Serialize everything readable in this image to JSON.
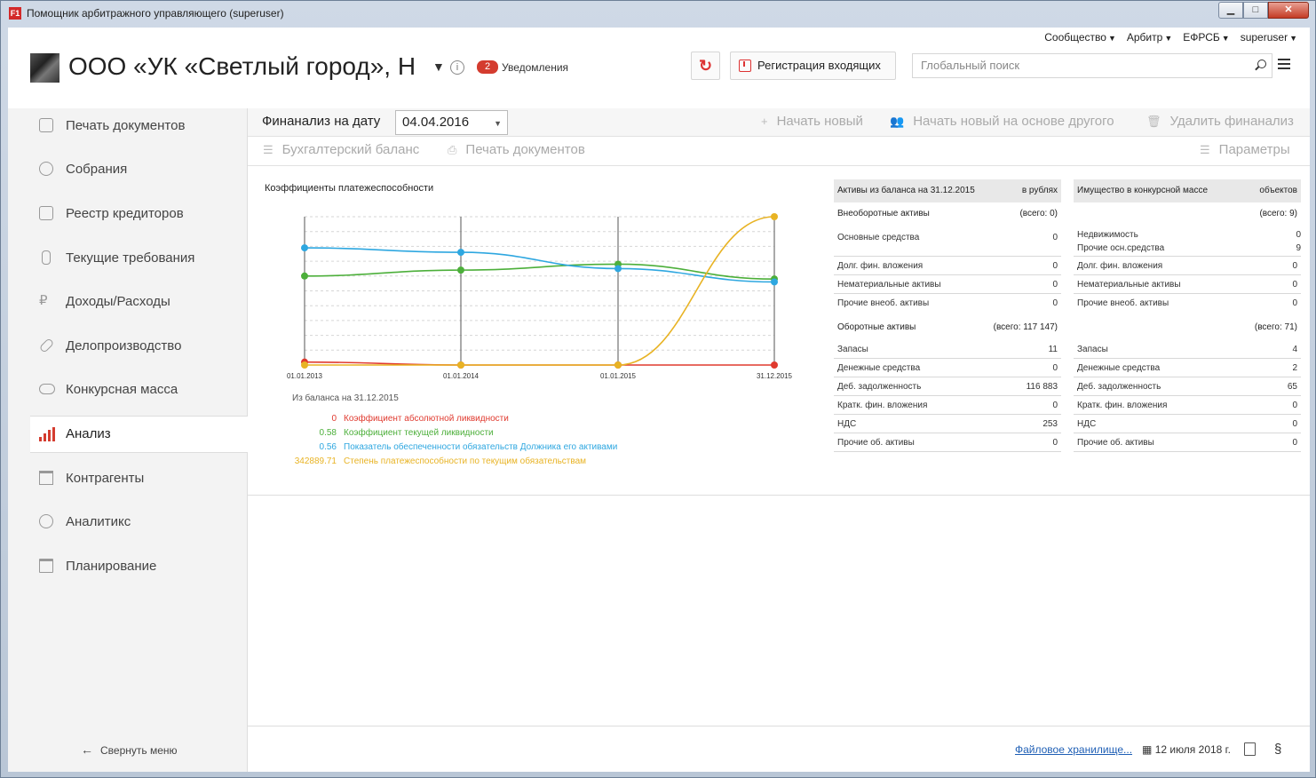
{
  "window": {
    "title": "Помощник арбитражного управляющего (superuser)",
    "min": "▁",
    "max": "□",
    "close": "✕",
    "app_icon": "F1"
  },
  "topmenu": [
    "Сообщество",
    "Арбитр",
    "ЕФРСБ",
    "superuser"
  ],
  "company": {
    "name": "ООО «УК «Светлый город», Н",
    "notif_count": "2",
    "notif_label": "Уведомления"
  },
  "header": {
    "register_label": "Регистрация входящих",
    "search_placeholder": "Глобальный поиск"
  },
  "sidebar": {
    "items": [
      {
        "label": "Печать документов",
        "icon": "document-icon"
      },
      {
        "label": "Собрания",
        "icon": "handshake-icon"
      },
      {
        "label": "Реестр кредиторов",
        "icon": "id-card-icon"
      },
      {
        "label": "Текущие требования",
        "icon": "bottle-icon"
      },
      {
        "label": "Доходы/Расходы",
        "icon": "ruble-icon"
      },
      {
        "label": "Делопроизводство",
        "icon": "paperclip-icon"
      },
      {
        "label": "Конкурсная масса",
        "icon": "cloud-icon"
      },
      {
        "label": "Анализ",
        "icon": "bar-chart-icon",
        "active": true
      },
      {
        "label": "Контрагенты",
        "icon": "bank-icon"
      },
      {
        "label": "Аналитикс",
        "icon": "gauge-icon"
      },
      {
        "label": "Планирование",
        "icon": "calendar-icon"
      }
    ],
    "collapse_label": "Свернуть меню"
  },
  "toolbar": {
    "fin_label": "Финанализ на дату",
    "date_value": "04.04.2016",
    "new_label": "Начать новый",
    "new_based_label": "Начать новый на основе другого",
    "delete_label": "Удалить финанализ",
    "balance_label": "Бухгалтерский баланс",
    "print_label": "Печать документов",
    "params_label": "Параметры"
  },
  "chart_data": {
    "type": "line",
    "title": "Коэффициенты платежеспособности",
    "x": [
      "01.01.2013",
      "01.01.2014",
      "01.01.2015",
      "31.12.2015"
    ],
    "ylim": [
      0,
      1.0
    ],
    "series": [
      {
        "name": "Коэффициент абсолютной ликвидности",
        "color": "#e03a2f",
        "values": [
          0.02,
          0.0,
          0.0,
          0.0
        ]
      },
      {
        "name": "Коэффициент текущей ликвидности",
        "color": "#4caf3a",
        "values": [
          0.6,
          0.64,
          0.68,
          0.58
        ]
      },
      {
        "name": "Показатель обеспеченности обязательств Должника его активами",
        "color": "#2ea7e0",
        "values": [
          0.79,
          0.76,
          0.65,
          0.56
        ]
      },
      {
        "name": "Степень платежеспособности по текущим обязательствам",
        "color": "#e8b324",
        "values": [
          0.0,
          0.0,
          0.0,
          1.0
        ]
      }
    ],
    "legend_source": "Из баланса на 31.12.2015",
    "legend_values": [
      "0",
      "0.58",
      "0.56",
      "342889.71"
    ]
  },
  "assets": {
    "title": "Активы из баланса на 31.12.2015",
    "unit": "в рублях",
    "noncurrent_label": "Внеоборотные активы",
    "noncurrent_total": "(всего: 0)",
    "noncurrent": [
      {
        "label": "Основные средства",
        "value": "0"
      },
      {
        "label": "Долг. фин. вложения",
        "value": "0"
      },
      {
        "label": "Нематериальные активы",
        "value": "0"
      },
      {
        "label": "Прочие внеоб. активы",
        "value": "0"
      }
    ],
    "current_label": "Оборотные активы",
    "current_total": "(всего: 117 147)",
    "current": [
      {
        "label": "Запасы",
        "value": "11"
      },
      {
        "label": "Денежные средства",
        "value": "0"
      },
      {
        "label": "Деб. задолженность",
        "value": "116 883"
      },
      {
        "label": "Кратк. фин. вложения",
        "value": "0"
      },
      {
        "label": "НДС",
        "value": "253"
      },
      {
        "label": "Прочие об. активы",
        "value": "0"
      }
    ]
  },
  "property": {
    "title": "Имущество в конкурсной массе",
    "unit": "объектов",
    "noncurrent_total": "(всего: 9)",
    "realty_label": "Недвижимость",
    "realty_value": "0",
    "other_fixed_label": "Прочие осн.средства",
    "other_fixed_value": "9",
    "noncurrent": [
      {
        "label": "Долг. фин. вложения",
        "value": "0"
      },
      {
        "label": "Нематериальные активы",
        "value": "0"
      },
      {
        "label": "Прочие внеоб. активы",
        "value": "0"
      }
    ],
    "current_total": "(всего: 71)",
    "current": [
      {
        "label": "Запасы",
        "value": "4"
      },
      {
        "label": "Денежные средства",
        "value": "2"
      },
      {
        "label": "Деб. задолженность",
        "value": "65"
      },
      {
        "label": "Кратк. фин. вложения",
        "value": "0"
      },
      {
        "label": "НДС",
        "value": "0"
      },
      {
        "label": "Прочие об. активы",
        "value": "0"
      }
    ]
  },
  "footer": {
    "storage_label": "Файловое хранилище...",
    "date_label": "12 июля 2018 г."
  }
}
